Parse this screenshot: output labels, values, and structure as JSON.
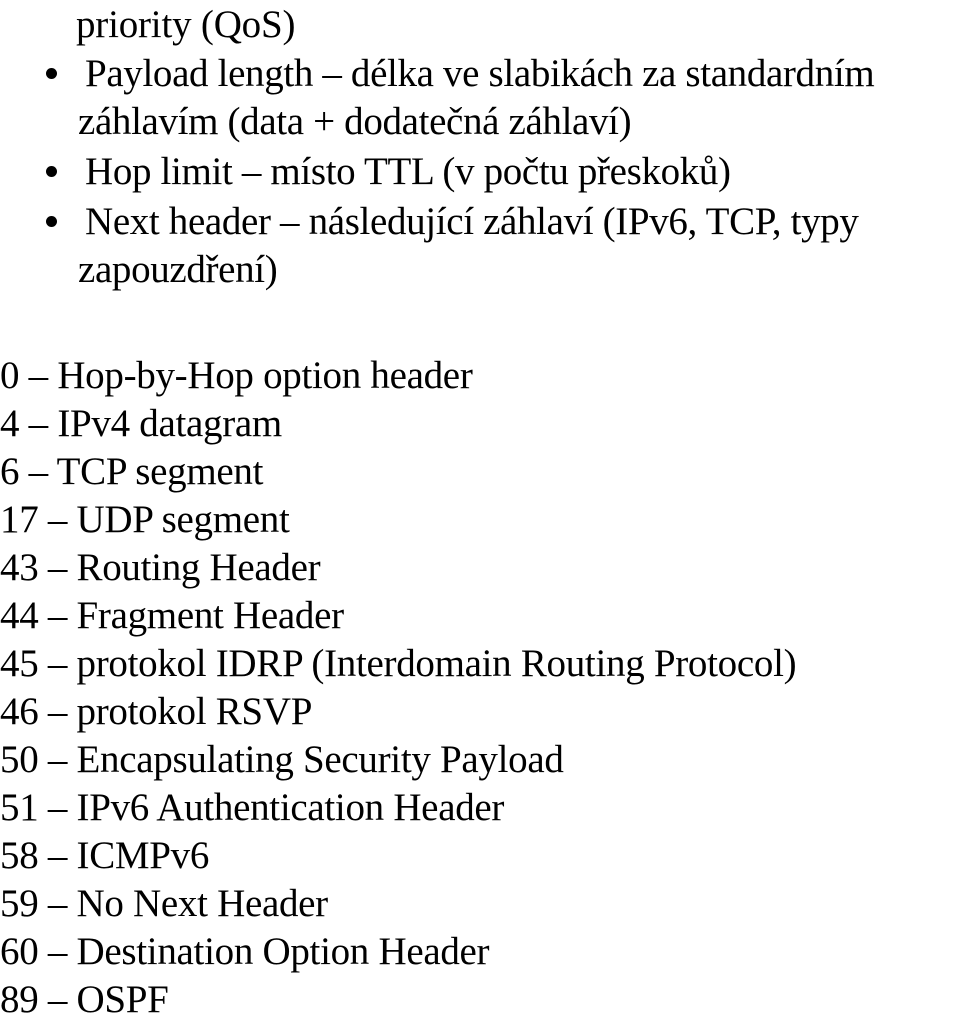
{
  "page": {
    "background_color": "#ffffff",
    "text_color": "#000000"
  },
  "top_continuation": {
    "text": "priority (QoS)"
  },
  "bullets": [
    {
      "marker": "bullet-dot",
      "line1": "Payload length – délka ve slabikách za standardním",
      "line2": "záhlavím (data + dodatečná záhlaví)"
    },
    {
      "marker": "bullet-dot",
      "line1": "Hop limit – místo TTL (v počtu přeskoků)",
      "line2": ""
    },
    {
      "marker": "bullet-dot",
      "line1": "Next header – následující záhlaví (IPv6, TCP, typy",
      "line2": "zapouzdření)"
    }
  ],
  "protocol_list": {
    "separator": "–",
    "rows": [
      {
        "number": "0",
        "description": "Hop-by-Hop option header"
      },
      {
        "number": "4",
        "description": "IPv4 datagram"
      },
      {
        "number": "6",
        "description": "TCP segment"
      },
      {
        "number": "17",
        "description": "UDP segment"
      },
      {
        "number": "43",
        "description": "Routing Header"
      },
      {
        "number": "44",
        "description": "Fragment Header"
      },
      {
        "number": "45",
        "description": "protokol IDRP (Interdomain Routing Protocol)"
      },
      {
        "number": "46",
        "description": "protokol RSVP"
      },
      {
        "number": "50",
        "description": "Encapsulating Security Payload"
      },
      {
        "number": "51",
        "description": "IPv6 Authentication Header"
      },
      {
        "number": "58",
        "description": "ICMPv6"
      },
      {
        "number": "59",
        "description": "No Next Header"
      },
      {
        "number": "60",
        "description": "Destination Option Header"
      },
      {
        "number": "89",
        "description": "OSPF"
      }
    ]
  }
}
